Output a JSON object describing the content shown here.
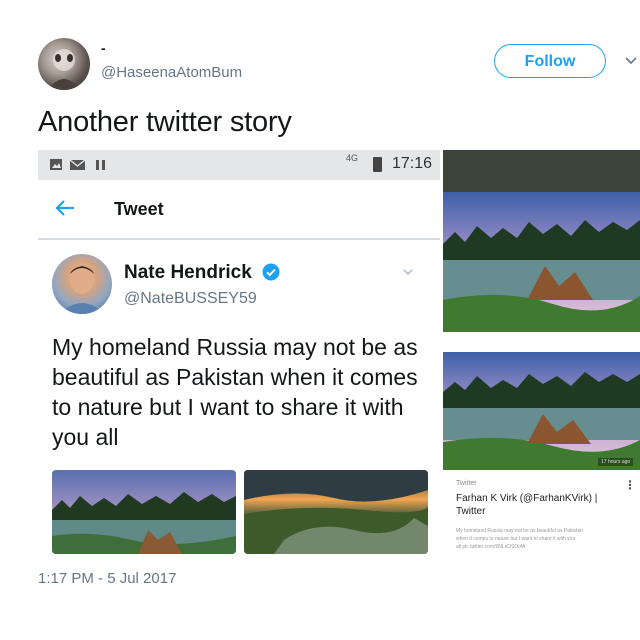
{
  "outer_tweet": {
    "display_name": "-",
    "handle": "@HaseenaAtomBum",
    "follow_label": "Follow",
    "text": "Another twitter story"
  },
  "phone": {
    "status_bar": {
      "network": "4G",
      "time": "17:16"
    },
    "app_bar": {
      "title": "Tweet"
    },
    "tweet": {
      "name": "Nate Hendrick",
      "handle": "@NateBUSSEY59",
      "text": "My homeland Russia may not be as beautiful as Pakistan when it comes to nature but I want to share it with you all",
      "timestamp": "1:17 PM - 5 Jul 2017"
    }
  },
  "side_card": {
    "badge": "17 hours ago",
    "label": "Twitter",
    "title": "Farhan K Virk (@FarhanKVirk) | Twitter",
    "desc_line1": "My homeland Russia may not be as beautiful as Pakistan",
    "desc_line2": "when it comes to nature but I want to share it with you",
    "desc_line3": "all pic.twitter.com/9NLeDSOi4A"
  },
  "icons": {
    "follow_chevron": "chevron-down-icon",
    "back": "arrow-left-icon",
    "verified": "verified-badge-icon"
  },
  "colors": {
    "accent": "#1da1f2",
    "muted": "#657786"
  }
}
